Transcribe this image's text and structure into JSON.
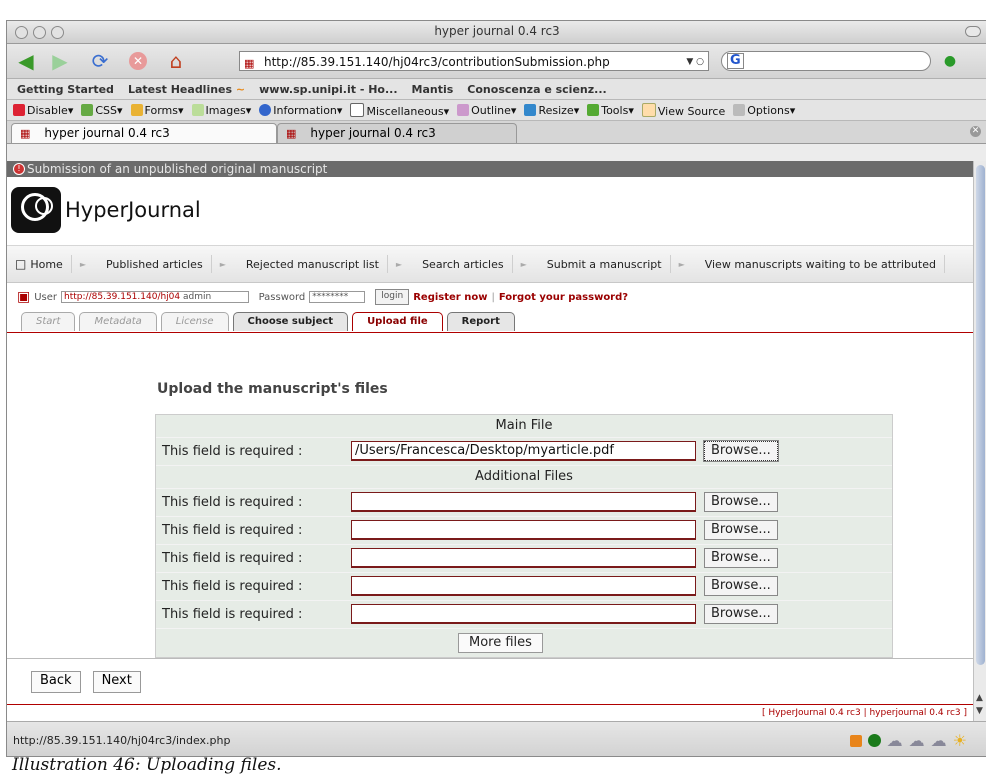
{
  "window": {
    "title": "hyper journal 0.4 rc3"
  },
  "toolbar": {
    "url": "http://85.39.151.140/hj04rc3/contributionSubmission.php",
    "search_engine_icon": "G"
  },
  "bookmarks": [
    "Getting Started",
    "Latest Headlines",
    "www.sp.unipi.it - Ho...",
    "Mantis",
    "Conoscenza e scienz..."
  ],
  "devbar": [
    "Disable",
    "CSS",
    "Forms",
    "Images",
    "Information",
    "Miscellaneous",
    "Outline",
    "Resize",
    "Tools",
    "View Source",
    "Options"
  ],
  "browser_tabs": [
    {
      "label": "hyper journal 0.4 rc3",
      "active": true
    },
    {
      "label": "hyper journal 0.4 rc3",
      "active": false
    }
  ],
  "page": {
    "header": "Submission of an unpublished original manuscript",
    "logo_text": "HyperJournal",
    "nav": [
      "Home",
      "Published articles",
      "Rejected manuscript list",
      "Search articles",
      "Submit a manuscript",
      "View manuscripts waiting to be attributed"
    ],
    "login": {
      "user_label": "User",
      "user_link": "http://85.39.151.140/hj04",
      "user_value": "admin",
      "password_label": "Password",
      "password_value": "********",
      "login_button": "login",
      "register": "Register now",
      "separator": "|",
      "forgot": "Forgot your password?"
    },
    "wizard_tabs": [
      "Start",
      "Metadata",
      "License",
      "Choose subject",
      "Upload file",
      "Report"
    ],
    "section_title": "Upload the manuscript's files",
    "main_file_heading": "Main File",
    "additional_heading": "Additional Files",
    "required_label": "This field is required :",
    "main_file_value": "/Users/Francesca/Desktop/myarticle.pdf",
    "browse_label": "Browse...",
    "more_files": "More files",
    "back": "Back",
    "next": "Next",
    "footer": "[ HyperJournal 0.4 rc3 | hyperjournal 0.4 rc3 ]"
  },
  "status": {
    "text": "http://85.39.151.140/hj04rc3/index.php"
  },
  "caption": "Illustration 46: Uploading files."
}
